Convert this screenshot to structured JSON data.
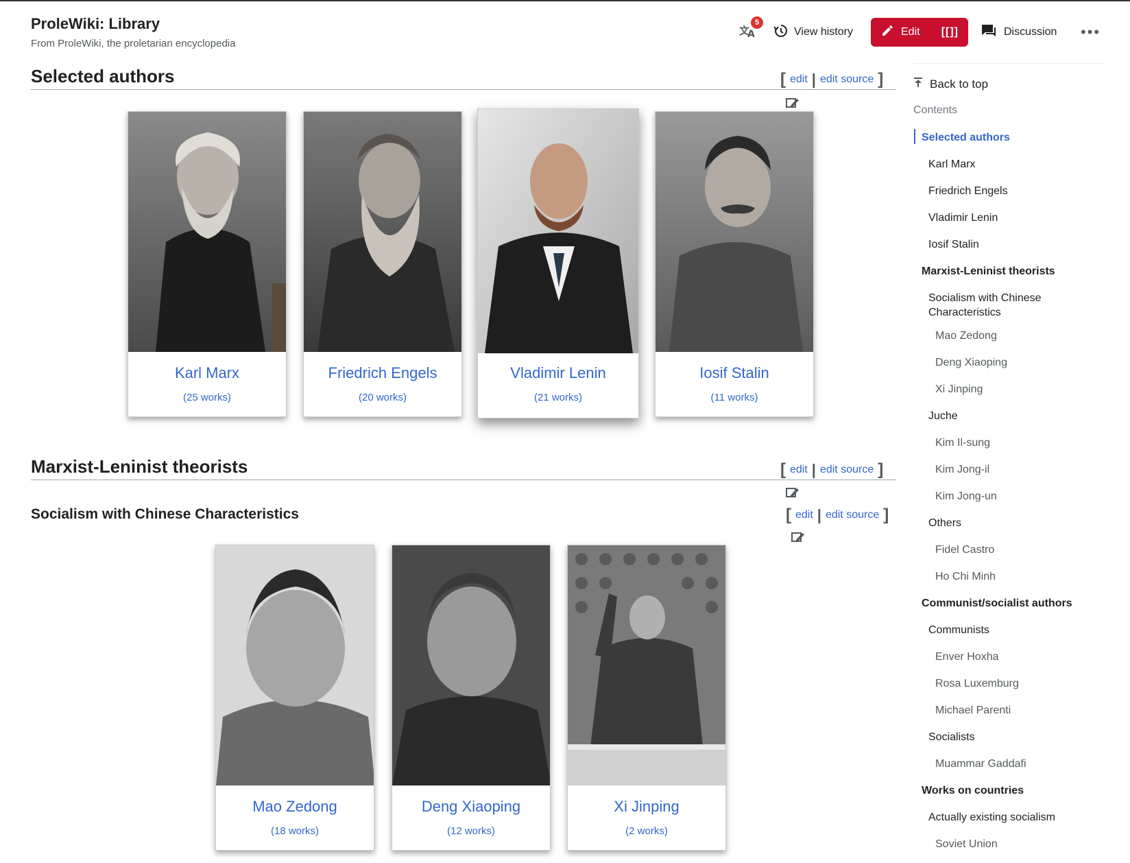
{
  "header": {
    "title": "ProleWiki: Library",
    "tagline": "From ProleWiki, the proletarian encyclopedia",
    "language_badge": "5",
    "view_history": "View history",
    "edit": "Edit",
    "edit_visual": "[[]]",
    "discussion": "Discussion",
    "more": "•••"
  },
  "edit_links": {
    "edit": "edit",
    "edit_source": "edit source",
    "bracket_open": "[",
    "bracket_close": "]",
    "separator": "|"
  },
  "sections": {
    "selected_authors": {
      "title": "Selected authors",
      "authors": [
        {
          "name": "Karl Marx",
          "works": "(25 works)"
        },
        {
          "name": "Friedrich Engels",
          "works": "(20 works)"
        },
        {
          "name": "Vladimir Lenin",
          "works": "(21 works)"
        },
        {
          "name": "Iosif Stalin",
          "works": "(11 works)"
        }
      ]
    },
    "ml_theorists": {
      "title": "Marxist-Leninist theorists"
    },
    "socialism_chinese": {
      "title": "Socialism with Chinese Characteristics",
      "authors": [
        {
          "name": "Mao Zedong",
          "works": "(18 works)"
        },
        {
          "name": "Deng Xiaoping",
          "works": "(12 works)"
        },
        {
          "name": "Xi Jinping",
          "works": "(2 works)"
        }
      ]
    }
  },
  "toc": {
    "back_to_top": "Back to top",
    "contents": "Contents",
    "items": [
      {
        "label": "Selected authors",
        "level": 1,
        "active": true
      },
      {
        "label": "Karl Marx",
        "level": 2
      },
      {
        "label": "Friedrich Engels",
        "level": 2
      },
      {
        "label": "Vladimir Lenin",
        "level": 2
      },
      {
        "label": "Iosif Stalin",
        "level": 2
      },
      {
        "label": "Marxist-Leninist theorists",
        "level": 1
      },
      {
        "label": "Socialism with Chinese Characteristics",
        "level": 2
      },
      {
        "label": "Mao Zedong",
        "level": 3
      },
      {
        "label": "Deng Xiaoping",
        "level": 3
      },
      {
        "label": "Xi Jinping",
        "level": 3
      },
      {
        "label": "Juche",
        "level": 2
      },
      {
        "label": "Kim Il-sung",
        "level": 3
      },
      {
        "label": "Kim Jong-il",
        "level": 3
      },
      {
        "label": "Kim Jong-un",
        "level": 3
      },
      {
        "label": "Others",
        "level": 2
      },
      {
        "label": "Fidel Castro",
        "level": 3
      },
      {
        "label": "Ho Chi Minh",
        "level": 3
      },
      {
        "label": "Communist/socialist authors",
        "level": 1
      },
      {
        "label": "Communists",
        "level": 2
      },
      {
        "label": "Enver Hoxha",
        "level": 3
      },
      {
        "label": "Rosa Luxemburg",
        "level": 3
      },
      {
        "label": "Michael Parenti",
        "level": 3
      },
      {
        "label": "Socialists",
        "level": 2
      },
      {
        "label": "Muammar Gaddafi",
        "level": 3
      },
      {
        "label": "Works on countries",
        "level": 1
      },
      {
        "label": "Actually existing socialism",
        "level": 2
      },
      {
        "label": "Soviet Union",
        "level": 3
      }
    ]
  },
  "colors": {
    "link": "#3366cc",
    "edit_button": "#c8102e",
    "text": "#202122",
    "muted": "#54595d"
  },
  "icons": {
    "language": "translate-icon",
    "history": "history-icon",
    "edit": "pencil-icon",
    "discussion": "speech-bubble-icon",
    "more": "ellipsis-icon",
    "back_to_top": "arrow-up-bar-icon",
    "section_edit": "edit-image-icon"
  }
}
